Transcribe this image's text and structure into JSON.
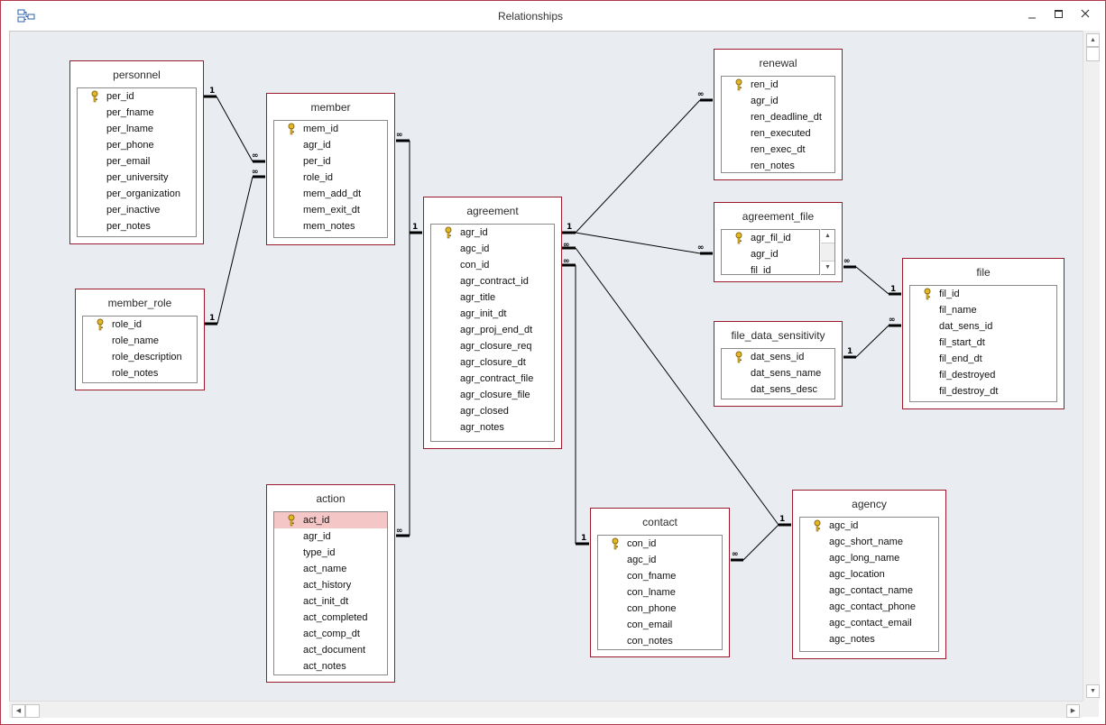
{
  "window": {
    "title": "Relationships",
    "controls": [
      "minimize",
      "maximize",
      "close"
    ]
  },
  "tables": {
    "personnel": {
      "title": "personnel",
      "fields": [
        "per_id",
        "per_fname",
        "per_lname",
        "per_phone",
        "per_email",
        "per_university",
        "per_organization",
        "per_inactive",
        "per_notes"
      ],
      "key_fields": [
        "per_id"
      ]
    },
    "member_role": {
      "title": "member_role",
      "fields": [
        "role_id",
        "role_name",
        "role_description",
        "role_notes"
      ],
      "key_fields": [
        "role_id"
      ]
    },
    "member": {
      "title": "member",
      "fields": [
        "mem_id",
        "agr_id",
        "per_id",
        "role_id",
        "mem_add_dt",
        "mem_exit_dt",
        "mem_notes"
      ],
      "key_fields": [
        "mem_id"
      ]
    },
    "agreement": {
      "title": "agreement",
      "fields": [
        "agr_id",
        "agc_id",
        "con_id",
        "agr_contract_id",
        "agr_title",
        "agr_init_dt",
        "agr_proj_end_dt",
        "agr_closure_req",
        "agr_closure_dt",
        "agr_contract_file",
        "agr_closure_file",
        "agr_closed",
        "agr_notes"
      ],
      "key_fields": [
        "agr_id"
      ]
    },
    "action": {
      "title": "action",
      "fields": [
        "act_id",
        "agr_id",
        "type_id",
        "act_name",
        "act_history",
        "act_init_dt",
        "act_completed",
        "act_comp_dt",
        "act_document",
        "act_notes"
      ],
      "key_fields": [
        "act_id"
      ],
      "highlighted_field": "act_id"
    },
    "renewal": {
      "title": "renewal",
      "fields": [
        "ren_id",
        "agr_id",
        "ren_deadline_dt",
        "ren_executed",
        "ren_exec_dt",
        "ren_notes"
      ],
      "key_fields": [
        "ren_id"
      ]
    },
    "agreement_file": {
      "title": "agreement_file",
      "fields": [
        "agr_fil_id",
        "agr_id",
        "fil_id"
      ],
      "key_fields": [
        "agr_fil_id"
      ]
    },
    "file_data_sensitivity": {
      "title": "file_data_sensitivity",
      "fields": [
        "dat_sens_id",
        "dat_sens_name",
        "dat_sens_desc"
      ],
      "key_fields": [
        "dat_sens_id"
      ]
    },
    "file": {
      "title": "file",
      "fields": [
        "fil_id",
        "fil_name",
        "dat_sens_id",
        "fil_start_dt",
        "fil_end_dt",
        "fil_destroyed",
        "fil_destroy_dt"
      ],
      "key_fields": [
        "fil_id"
      ]
    },
    "contact": {
      "title": "contact",
      "fields": [
        "con_id",
        "agc_id",
        "con_fname",
        "con_lname",
        "con_phone",
        "con_email",
        "con_notes"
      ],
      "key_fields": [
        "con_id"
      ]
    },
    "agency": {
      "title": "agency",
      "fields": [
        "agc_id",
        "agc_short_name",
        "agc_long_name",
        "agc_location",
        "agc_contact_name",
        "agc_contact_phone",
        "agc_contact_email",
        "agc_notes"
      ],
      "key_fields": [
        "agc_id"
      ]
    }
  },
  "relationships": [
    {
      "from": "personnel.per_id",
      "to": "member.per_id",
      "from_card": "1",
      "to_card": "∞"
    },
    {
      "from": "member_role.role_id",
      "to": "member.role_id",
      "from_card": "1",
      "to_card": "∞"
    },
    {
      "from": "agreement.agr_id",
      "to": "member.agr_id",
      "from_card": "1",
      "to_card": "∞"
    },
    {
      "from": "agreement.agr_id",
      "to": "action.agr_id",
      "from_card": "1",
      "to_card": "∞"
    },
    {
      "from": "agreement.agr_id",
      "to": "renewal.agr_id",
      "from_card": "1",
      "to_card": "∞"
    },
    {
      "from": "agreement.agr_id",
      "to": "agreement_file.agr_id",
      "from_card": "1",
      "to_card": "∞"
    },
    {
      "from": "file.fil_id",
      "to": "agreement_file.fil_id",
      "from_card": "1",
      "to_card": "∞"
    },
    {
      "from": "file_data_sensitivity.dat_sens_id",
      "to": "file.dat_sens_id",
      "from_card": "1",
      "to_card": "∞"
    },
    {
      "from": "contact.con_id",
      "to": "agreement.con_id",
      "from_card": "1",
      "to_card": "∞"
    },
    {
      "from": "agency.agc_id",
      "to": "agreement.agc_id",
      "from_card": "1",
      "to_card": "∞"
    },
    {
      "from": "agency.agc_id",
      "to": "contact.agc_id",
      "from_card": "1",
      "to_card": "∞"
    }
  ],
  "colors": {
    "table_border": "#9b1b2c",
    "canvas_bg": "#e9edf2",
    "highlight": "#f4c6c6",
    "window_border": "#b0394d"
  },
  "icons": {
    "app": "relationships-icon",
    "key": "key-icon"
  }
}
